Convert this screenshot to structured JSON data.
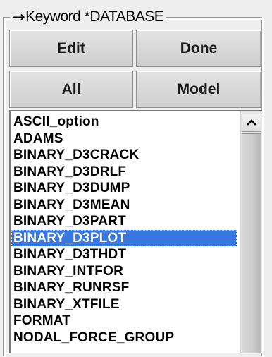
{
  "panel": {
    "arrow_glyph": "→",
    "title": "Keyword *DATABASE"
  },
  "buttons": {
    "edit": "Edit",
    "done": "Done",
    "all": "All",
    "model": "Model"
  },
  "keyword_list": {
    "items": [
      "ASCII_option",
      "ADAMS",
      "BINARY_D3CRACK",
      "BINARY_D3DRLF",
      "BINARY_D3DUMP",
      "BINARY_D3MEAN",
      "BINARY_D3PART",
      "BINARY_D3PLOT",
      "BINARY_D3THDT",
      "BINARY_INTFOR",
      "BINARY_RUNRSF",
      "BINARY_XTFILE",
      "FORMAT",
      "NODAL_FORCE_GROUP"
    ],
    "selected_index": 7,
    "selection_color": "#3876e0"
  },
  "scrollbar": {
    "up_icon": "chevron-up-icon"
  }
}
